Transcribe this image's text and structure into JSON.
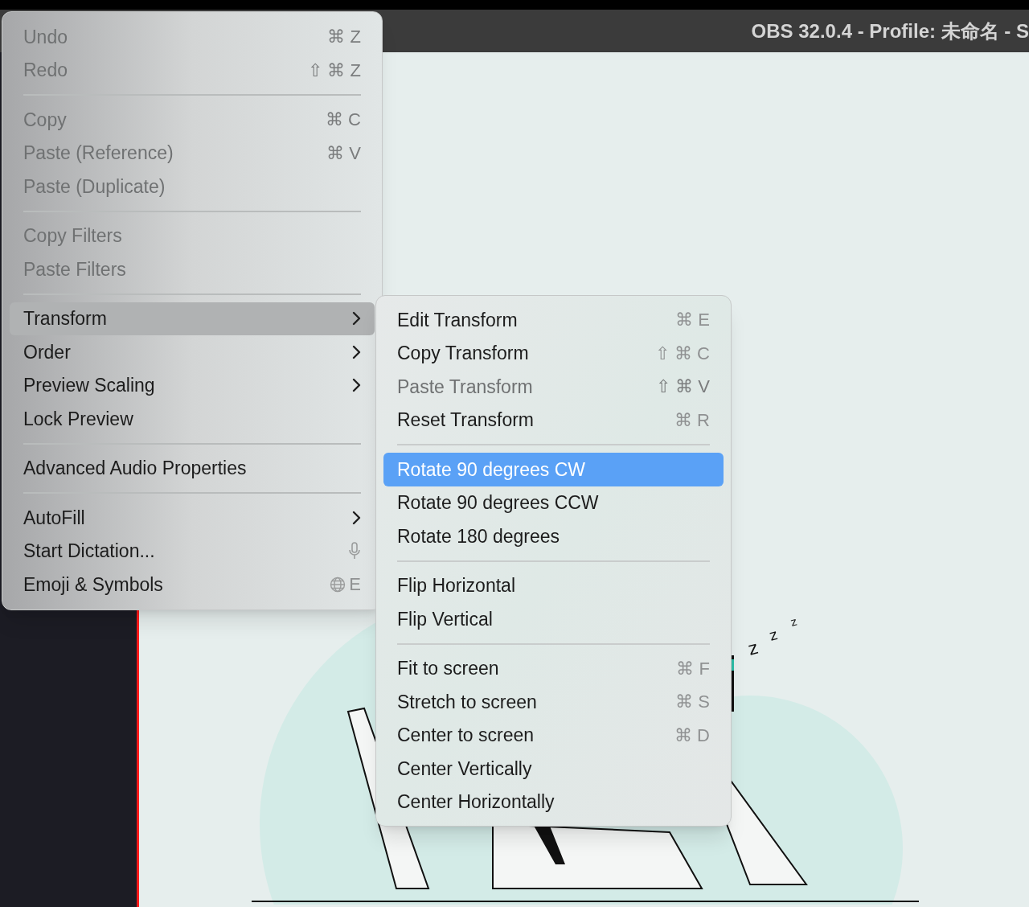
{
  "window": {
    "title": "OBS 32.0.4 - Profile: 未命名 - S"
  },
  "context_menu": {
    "items": [
      {
        "kind": "item",
        "label": "Undo",
        "shortcut": "⌘ Z",
        "disabled": true,
        "selected": false
      },
      {
        "kind": "item",
        "label": "Redo",
        "shortcut": "⇧ ⌘ Z",
        "disabled": true,
        "selected": false
      },
      {
        "kind": "separator"
      },
      {
        "kind": "item",
        "label": "Copy",
        "shortcut": "⌘ C",
        "disabled": true,
        "selected": false
      },
      {
        "kind": "item",
        "label": "Paste (Reference)",
        "shortcut": "⌘ V",
        "disabled": true,
        "selected": false
      },
      {
        "kind": "item",
        "label": "Paste (Duplicate)",
        "disabled": true,
        "selected": false
      },
      {
        "kind": "separator"
      },
      {
        "kind": "item",
        "label": "Copy Filters",
        "disabled": true,
        "selected": false
      },
      {
        "kind": "item",
        "label": "Paste Filters",
        "disabled": true,
        "selected": false
      },
      {
        "kind": "separator"
      },
      {
        "kind": "submenu",
        "label": "Transform",
        "disabled": false,
        "selected": true
      },
      {
        "kind": "submenu",
        "label": "Order",
        "disabled": false,
        "selected": false
      },
      {
        "kind": "submenu",
        "label": "Preview Scaling",
        "disabled": false,
        "selected": false
      },
      {
        "kind": "item",
        "label": "Lock Preview",
        "disabled": false,
        "selected": false
      },
      {
        "kind": "separator"
      },
      {
        "kind": "item",
        "label": "Advanced Audio Properties",
        "disabled": false,
        "selected": false
      },
      {
        "kind": "separator"
      },
      {
        "kind": "submenu",
        "label": "AutoFill",
        "disabled": false,
        "selected": false
      },
      {
        "kind": "dictation",
        "label": "Start Dictation...",
        "disabled": false,
        "selected": false
      },
      {
        "kind": "emoji",
        "label": "Emoji & Symbols",
        "shortcut": "E",
        "disabled": false,
        "selected": false
      }
    ]
  },
  "transform_submenu": {
    "items": [
      {
        "kind": "item",
        "label": "Edit Transform",
        "shortcut": "⌘ E",
        "disabled": false,
        "selected": false
      },
      {
        "kind": "item",
        "label": "Copy Transform",
        "shortcut": "⇧ ⌘ C",
        "disabled": false,
        "selected": false
      },
      {
        "kind": "item",
        "label": "Paste Transform",
        "shortcut": "⇧ ⌘ V",
        "disabled": true,
        "selected": false
      },
      {
        "kind": "item",
        "label": "Reset Transform",
        "shortcut": "⌘ R",
        "disabled": false,
        "selected": false
      },
      {
        "kind": "separator"
      },
      {
        "kind": "item",
        "label": "Rotate 90 degrees CW",
        "disabled": false,
        "selected": true
      },
      {
        "kind": "item",
        "label": "Rotate 90 degrees CCW",
        "disabled": false,
        "selected": false
      },
      {
        "kind": "item",
        "label": "Rotate 180 degrees",
        "disabled": false,
        "selected": false
      },
      {
        "kind": "separator"
      },
      {
        "kind": "item",
        "label": "Flip Horizontal",
        "disabled": false,
        "selected": false
      },
      {
        "kind": "item",
        "label": "Flip Vertical",
        "disabled": false,
        "selected": false
      },
      {
        "kind": "separator"
      },
      {
        "kind": "item",
        "label": "Fit to screen",
        "shortcut": "⌘ F",
        "disabled": false,
        "selected": false
      },
      {
        "kind": "item",
        "label": "Stretch to screen",
        "shortcut": "⌘ S",
        "disabled": false,
        "selected": false
      },
      {
        "kind": "item",
        "label": "Center to screen",
        "shortcut": "⌘ D",
        "disabled": false,
        "selected": false
      },
      {
        "kind": "item",
        "label": "Center Vertically",
        "disabled": false,
        "selected": false
      },
      {
        "kind": "item",
        "label": "Center Horizontally",
        "disabled": false,
        "selected": false
      }
    ]
  },
  "preview": {
    "snore": [
      "z",
      "z",
      "z"
    ]
  }
}
